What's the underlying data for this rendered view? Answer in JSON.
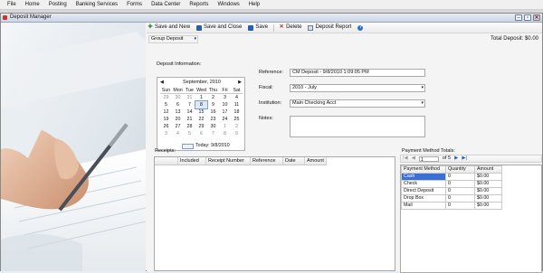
{
  "menu": [
    "File",
    "Home",
    "Posting",
    "Banking Services",
    "Forms",
    "Data Center",
    "Reports",
    "Windows",
    "Help"
  ],
  "window": {
    "title": "Deposit Manager",
    "buttons": {
      "minimize": "–",
      "maximize": "▫",
      "close": "✕"
    }
  },
  "toolbar": {
    "save_new": "Save and New",
    "save_close": "Save and Close",
    "save": "Save",
    "delete": "Delete",
    "deposit_report": "Deposit Report",
    "help_icon": "?"
  },
  "group_combo": "Group Deposit",
  "total_deposit": "Total Deposit: $0.00",
  "deposit_info_label": "Deposit Information:",
  "calendar": {
    "prev": "◀",
    "next": "▶",
    "month": "September, 2010",
    "dow": [
      "Sun",
      "Mon",
      "Tue",
      "Wed",
      "Thu",
      "Fri",
      "Sat"
    ],
    "weeks": [
      [
        "29",
        "30",
        "31",
        "1",
        "2",
        "3",
        "4"
      ],
      [
        "5",
        "6",
        "7",
        "8",
        "9",
        "10",
        "11"
      ],
      [
        "12",
        "13",
        "14",
        "15",
        "16",
        "17",
        "18"
      ],
      [
        "19",
        "20",
        "21",
        "22",
        "23",
        "24",
        "25"
      ],
      [
        "26",
        "27",
        "28",
        "29",
        "30",
        "1",
        "2"
      ],
      [
        "3",
        "4",
        "5",
        "6",
        "7",
        "8",
        "9"
      ]
    ],
    "selected_day": "8",
    "today": "Today: 9/8/2010"
  },
  "form": {
    "reference_label": "Reference:",
    "reference_value": "CM Deposit - 9/8/2010 1:09:05 PM",
    "fiscal_label": "Fiscal:",
    "fiscal_value": "2010 - July",
    "institution_label": "Institution:",
    "institution_value": "Main Checking Acct",
    "notes_label": "Notes:"
  },
  "receipts": {
    "title": "Receipts:",
    "columns": [
      "Included",
      "Receipt Number",
      "Reference",
      "Date",
      "Amount"
    ]
  },
  "payment_totals": {
    "title": "Payment Method Totals:",
    "pager": {
      "first": "|◀",
      "prev": "◀",
      "page": "1",
      "of": "of 5",
      "next": "▶",
      "last": "▶|"
    },
    "columns": [
      "Payment Method",
      "Quantity",
      "Amount"
    ],
    "rows": [
      {
        "method": "Cash",
        "qty": "0",
        "amount": "$0.00"
      },
      {
        "method": "Check",
        "qty": "0",
        "amount": "$0.00"
      },
      {
        "method": "Direct Deposit",
        "qty": "0",
        "amount": "$0.00"
      },
      {
        "method": "Drop Box",
        "qty": "0",
        "amount": "$0.00"
      },
      {
        "method": "Mail",
        "qty": "0",
        "amount": "$0.00"
      }
    ]
  }
}
